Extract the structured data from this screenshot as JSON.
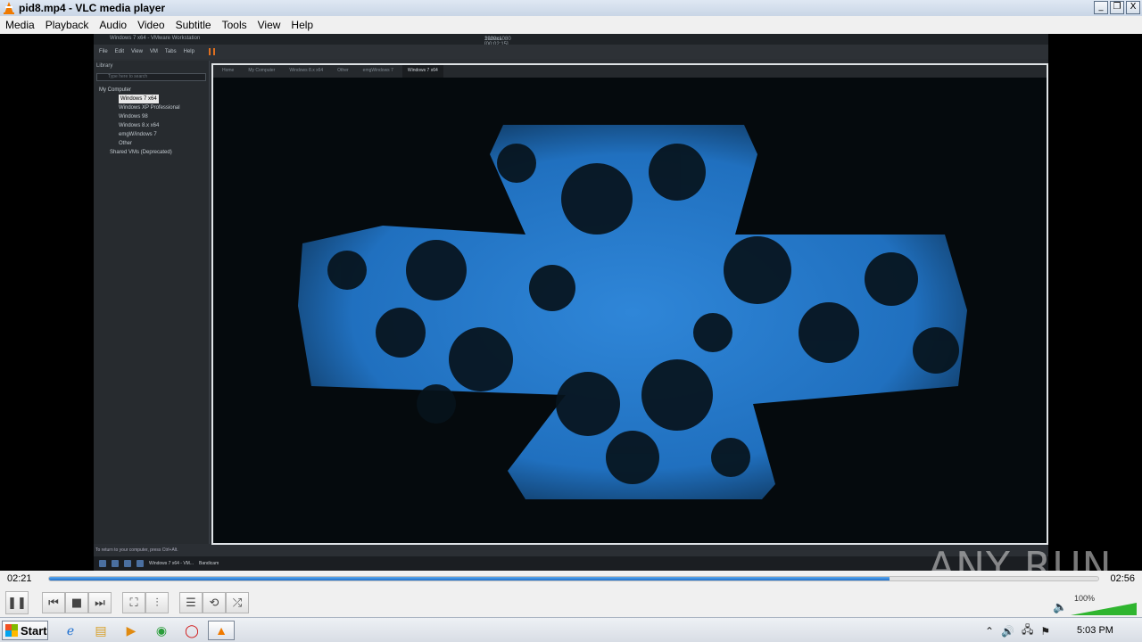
{
  "window": {
    "title": "pid8.mp4 - VLC media player",
    "buttons": [
      "_",
      "❐",
      "X"
    ]
  },
  "menu": [
    "Media",
    "Playback",
    "Audio",
    "Video",
    "Subtitle",
    "Tools",
    "View",
    "Help"
  ],
  "video_content": {
    "vm_title": "Windows 7 x64 - VMware Workstation",
    "vm_recorder": [
      "1920x1080",
      "Запись [00:02:15]"
    ],
    "vm_menu": [
      "File",
      "Edit",
      "View",
      "VM",
      "Tabs",
      "Help"
    ],
    "library_header": "Library",
    "library_search_placeholder": "Type here to search",
    "library_tree": [
      "My Computer",
      "Windows 7 x64",
      "Windows XP Professional",
      "Windows 98",
      "Windows 8.x x64",
      "emgW/indows 7",
      "Other",
      "Shared VMs (Deprecated)"
    ],
    "vm_tabs": [
      "Home",
      "My Computer",
      "Windows 8.x x64",
      "Other",
      "emgWindows 7",
      "Windows 7 x64"
    ],
    "vm_status": "To return to your computer, press Ctrl+Alt.",
    "vm_taskbar_items": [
      "Windows 7 x64 - VM...",
      "Bandicam"
    ],
    "watermark": "ANY RUN"
  },
  "playback": {
    "current_time": "02:21",
    "total_time": "02:56",
    "progress_fraction": 0.801
  },
  "controls": {
    "play": "❚❚",
    "prev": "⏮",
    "stop": "■",
    "next": "⏭",
    "fullscreen": "⛶",
    "extended": "⫶",
    "playlist": "☰",
    "loop": "⟲",
    "shuffle": "⤮",
    "volume_icon": "🔈",
    "volume": "100%",
    "volume_fraction": 1.0
  },
  "taskbar": {
    "start_label": "Start",
    "icons": [
      "ie-icon",
      "explorer-icon",
      "media-player-icon",
      "chrome-icon",
      "opera-icon",
      "vlc-icon"
    ],
    "tray": [
      "⌃",
      "🔊",
      "🖧",
      "⚑"
    ],
    "clock": "5:03 PM"
  },
  "colors": {
    "accent": "#1f6fc9",
    "vlc_orange": "#f07a00"
  }
}
